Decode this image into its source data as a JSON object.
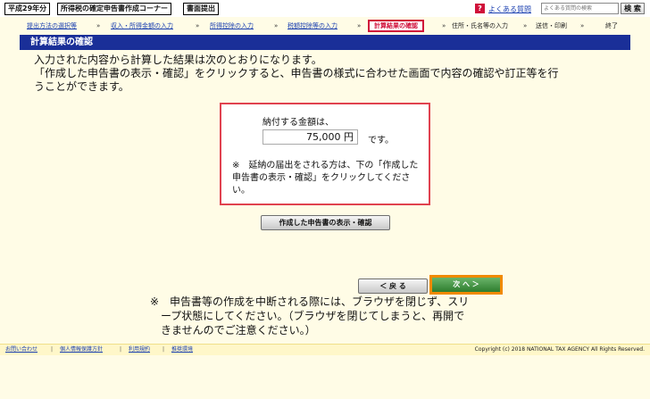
{
  "topbar": {
    "tags": [
      "平成29年分",
      "所得税の確定申告書作成コーナー",
      "書面提出"
    ],
    "help_icon": "?",
    "faq_label": "よくある質問",
    "search_placeholder": "よくある質問の検索",
    "search_button": "検 索"
  },
  "steps": [
    {
      "label": "提出方法の選択等",
      "state": "done"
    },
    {
      "label": "収入・所得金額の入力",
      "state": "done"
    },
    {
      "label": "所得控除の入力",
      "state": "done"
    },
    {
      "label": "税額控除等の入力",
      "state": "done"
    },
    {
      "label": "計算結果の確認",
      "state": "current"
    },
    {
      "label": "住所・氏名等の入力",
      "state": "todo"
    },
    {
      "label": "送信・印刷",
      "state": "todo"
    },
    {
      "label": "終了",
      "state": "todo"
    }
  ],
  "step_arrow": "»",
  "section_title": "計算結果の確認",
  "intro": {
    "line1": "入力された内容から計算した結果は次のとおりになります。",
    "line2": "「作成した申告書の表示・確認」をクリックすると、申告書の様式に合わせた画面で内容の確認や訂正等を行",
    "line3": "うことができます。"
  },
  "result": {
    "label": "納付する金額は、",
    "amount": "75,000 円",
    "suffix": "です。",
    "note": "※　延納の届出をされる方は、下の「作成した申告書の表示・確認」をクリックしてください。"
  },
  "buttons": {
    "show_confirm": "作成した申告書の表示・確認",
    "back": "＜ 戻 る",
    "next": "次 へ ＞"
  },
  "warning": {
    "line1": "※　申告書等の作成を中断される際には、ブラウザを閉じず、スリ",
    "line2": "ープ状態にしてください。（ブラウザを閉じてしまうと、再開で",
    "line3": "きませんのでご注意ください。）"
  },
  "footer": {
    "links": [
      "お問い合わせ",
      "個人情報保護方針",
      "利用規約",
      "推奨環境"
    ],
    "separator": "|",
    "copyright": "Copyright (c) 2018 NATIONAL TAX AGENCY All Rights Reserved."
  },
  "colors": {
    "background": "#fffce6",
    "header_blue": "#1a2f98",
    "link_blue": "#1a3fb0",
    "current_step_red": "#d0103a",
    "highlight_orange": "#f08a00",
    "next_green": "#2e7d2e"
  }
}
